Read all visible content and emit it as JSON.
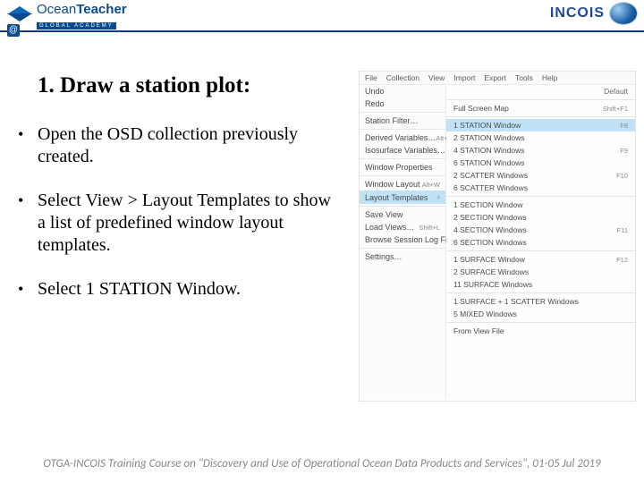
{
  "logos": {
    "oceanteacher": {
      "line1a": "Ocean",
      "line1b": "Teacher",
      "line2": "GLOBAL ACADEMY",
      "at": "@"
    },
    "incois": "INCOIS"
  },
  "heading": "1. Draw a station plot:",
  "bullets": [
    "Open the OSD collection previously created.",
    "Select View > Layout Templates to show a list of predefined window layout templates.",
    " Select 1 STATION Window."
  ],
  "menubar": [
    "File",
    "Collection",
    "View",
    "Import",
    "Export",
    "Tools",
    "Help"
  ],
  "viewMenu": [
    {
      "label": "Undo",
      "sep": false
    },
    {
      "label": "Redo",
      "sep": false
    },
    {
      "sep": true
    },
    {
      "label": "Station Filter…",
      "sep": false
    },
    {
      "sep": true
    },
    {
      "label": "Derived Variables…",
      "kbd": "Alt+D",
      "sep": false
    },
    {
      "label": "Isosurface Variables…",
      "sep": false
    },
    {
      "sep": true
    },
    {
      "label": "Window Properties",
      "sep": false
    },
    {
      "sep": true
    },
    {
      "label": "Window Layout",
      "kbd": "Alt+W",
      "sep": false
    },
    {
      "label": "Layout Templates",
      "hi": true,
      "chev": true,
      "sep": false
    },
    {
      "sep": true
    },
    {
      "label": "Save View",
      "sep": false
    },
    {
      "label": "Load Views…",
      "kbd": "Shift+L",
      "sep": false
    },
    {
      "label": "Browse Session Log File",
      "sep": false
    },
    {
      "sep": true
    },
    {
      "label": "Settings…",
      "sep": false
    }
  ],
  "layoutMenu": {
    "default": "Default",
    "groups": [
      [
        {
          "label": "Full Screen Map",
          "kbd": "Shift+F1"
        }
      ],
      [
        {
          "label": "1 STATION Window",
          "kbd": "F8",
          "hi": true
        },
        {
          "label": "2 STATION Windows"
        },
        {
          "label": "4 STATION Windows",
          "kbd": "F9"
        },
        {
          "label": "6 STATION Windows"
        },
        {
          "label": "2 SCATTER Windows",
          "kbd": "F10"
        },
        {
          "label": "6 SCATTER Windows"
        }
      ],
      [
        {
          "label": "1 SECTION Window"
        },
        {
          "label": "2 SECTION Windows"
        },
        {
          "label": "4 SECTION Windows",
          "kbd": "F11"
        },
        {
          "label": "6 SECTION Windows"
        }
      ],
      [
        {
          "label": "1 SURFACE Window",
          "kbd": "F12"
        },
        {
          "label": "2 SURFACE Windows"
        },
        {
          "label": "11 SURFACE Windows"
        }
      ],
      [
        {
          "label": "1 SURFACE + 1 SCATTER Windows"
        },
        {
          "label": "5 MIXED Windows"
        }
      ],
      [
        {
          "label": "From View File"
        }
      ]
    ]
  },
  "footer": "OTGA-INCOIS Training Course on \"Discovery and Use of Operational Ocean Data Products and Services\", 01-05 Jul 2019"
}
